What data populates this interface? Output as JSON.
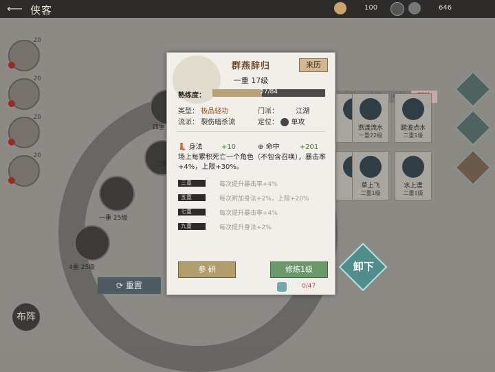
{
  "topbar": {
    "title": "侠客",
    "resource1": "100",
    "resource2": "646"
  },
  "avatars": [
    {
      "level": "20"
    },
    {
      "level": "20"
    },
    {
      "level": "20"
    },
    {
      "level": "20"
    }
  ],
  "skill_tree": {
    "nodes": [
      {
        "caption": "一重 25级"
      },
      {
        "caption": "4重 25级"
      },
      {
        "caption": "四重"
      },
      {
        "caption": "二重"
      }
    ],
    "reset_label": "重置",
    "bottom_logo": "布阵"
  },
  "right_panel": {
    "tabs": [
      "内功",
      "绝招",
      "心法",
      "轻功"
    ],
    "cards": [
      {
        "name": "",
        "level": ""
      },
      {
        "name": "燕漾流水",
        "level": "一重22级"
      },
      {
        "name": "踏波点水",
        "level": "二重1级"
      },
      {
        "name": "",
        "level": ""
      },
      {
        "name": "草上飞",
        "level": "二重1级"
      },
      {
        "name": "水上漂",
        "level": "二重1级"
      }
    ],
    "unload_label": "卸下"
  },
  "dialog": {
    "title": "群燕辞归",
    "source_button": "来历",
    "level": "一重 17级",
    "proficiency_label": "熟练度：",
    "proficiency_text": "37/84",
    "proficiency_value": 0.44,
    "type_label": "类型：",
    "type_value": "极品轻功",
    "sect_label": "门派：",
    "sect_value": "江湖",
    "school_label": "流派：",
    "school_value": "裂伤暗杀流",
    "role_label": "定位：",
    "role_value": "单攻",
    "stat1_label": "身法",
    "stat1_value": "+10",
    "stat2_label": "命中",
    "stat2_value": "+201",
    "description": "场上每累积死亡一个角色（不包含召唤），暴击率+4%，上限+30%。",
    "perks": [
      {
        "tag": "三重",
        "text": "每次提升暴击率+4%"
      },
      {
        "tag": "五重",
        "text": "每次附加身法+2%，上限+20%"
      },
      {
        "tag": "七重",
        "text": "每次提升暴击率+4%"
      },
      {
        "tag": "九重",
        "text": "每次提升身法+2%"
      }
    ],
    "research_button": "参 研",
    "train_button": "修炼1级",
    "cost": "0/47"
  }
}
